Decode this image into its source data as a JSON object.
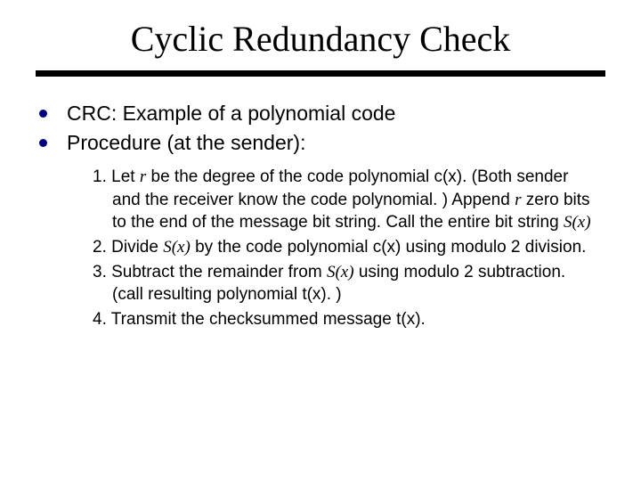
{
  "title": "Cyclic Redundancy Check",
  "bullets": [
    "CRC: Example of a polynomial code",
    "Procedure (at the sender):"
  ],
  "items": {
    "n1a": "1. Let ",
    "n1r1": "r",
    "n1b": " be the degree of the code polynomial c(x).  (Both sender and the receiver know the code polynomial. )  Append ",
    "n1r2": "r",
    "n1c": " zero bits to the end of the message bit string.  Call the entire bit string ",
    "n1sx": "S(x)",
    "n2a": "2. Divide ",
    "n2sx": "S(x)",
    "n2b": " by the code polynomial c(x) using modulo 2 division.",
    "n3a": "3. Subtract the remainder from ",
    "n3sx": "S(x)",
    "n3b": " using modulo 2 subtraction. (call resulting polynomial t(x). )",
    "n4": "4. Transmit the checksummed message t(x)."
  }
}
